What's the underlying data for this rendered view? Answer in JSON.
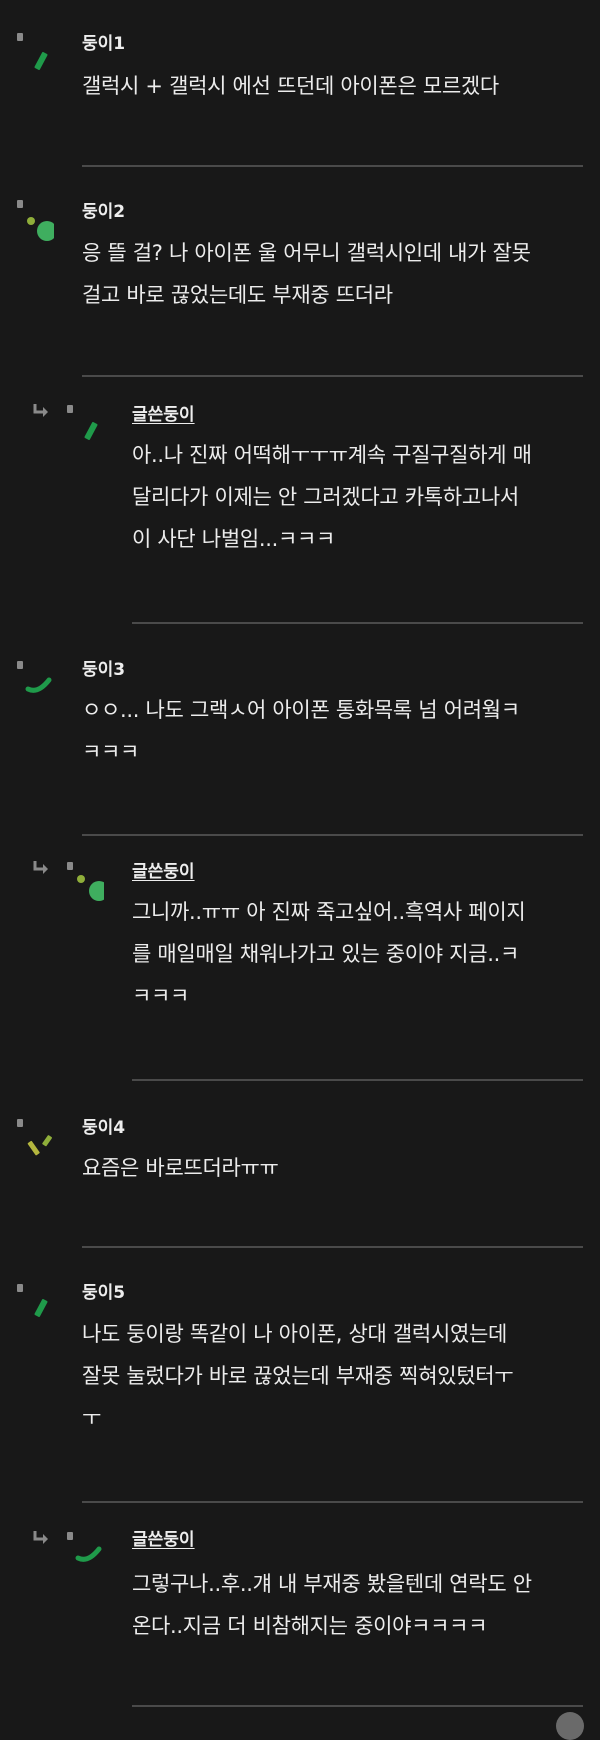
{
  "comments": [
    {
      "author": "둥이1",
      "is_reply": false,
      "lines": [
        "갤럭시 + 갤럭시 에선 뜨던데 아이폰은 모르겠다"
      ]
    },
    {
      "author": "둥이2",
      "is_reply": false,
      "lines": [
        "응 뜰 걸? 나 아이폰 울 어무니 갤럭시인데 내가 잘못",
        "걸고 바로 끊었는데도 부재중 뜨더라"
      ]
    },
    {
      "author": "글쓴둥이",
      "is_reply": true,
      "lines": [
        "아..나 진짜 어떡해ㅜㅜㅠ계속 구질구질하게 매",
        "달리다가 이제는 안 그러겠다고 카톡하고나서",
        "이 사단 나벌임...ㅋㅋㅋ"
      ]
    },
    {
      "author": "둥이3",
      "is_reply": false,
      "lines": [
        "ㅇㅇ... 나도 그랙ㅅ어 아이폰 통화목록 넘 어려웤ㅋ",
        "ㅋㅋㅋ"
      ]
    },
    {
      "author": "글쓴둥이",
      "is_reply": true,
      "lines": [
        "그니까..ㅠㅠ 아 진짜 죽고싶어..흑역사 페이지",
        "를 매일매일 채워나가고 있는 중이야 지금..ㅋ",
        "ㅋㅋㅋ"
      ]
    },
    {
      "author": "둥이4",
      "is_reply": false,
      "lines": [
        "요즘은 바로뜨더라ㅠㅠ"
      ]
    },
    {
      "author": "둥이5",
      "is_reply": false,
      "lines": [
        "나도 둥이랑 똑같이 나 아이폰, 상대 갤럭시였는데",
        "잘못 눌렀다가 바로 끊었는데 부재중 찍혀있텄터ㅜ",
        "ㅜ"
      ]
    },
    {
      "author": "글쓴둥이",
      "is_reply": true,
      "lines": [
        "그렇구나..후..걔 내 부재중 봤을텐데 연락도 안",
        "온다..지금 더 비참해지는 중이야ㅋㅋㅋㅋ"
      ]
    }
  ],
  "colors": {
    "background": "#181818",
    "text": "#ececec",
    "divider": "#4a4a4a",
    "deco_green": "#1f9a4a",
    "deco_green_light": "#3fae5f",
    "deco_olive": "#8fae3a",
    "deco_yellow": "#b4b63e"
  }
}
